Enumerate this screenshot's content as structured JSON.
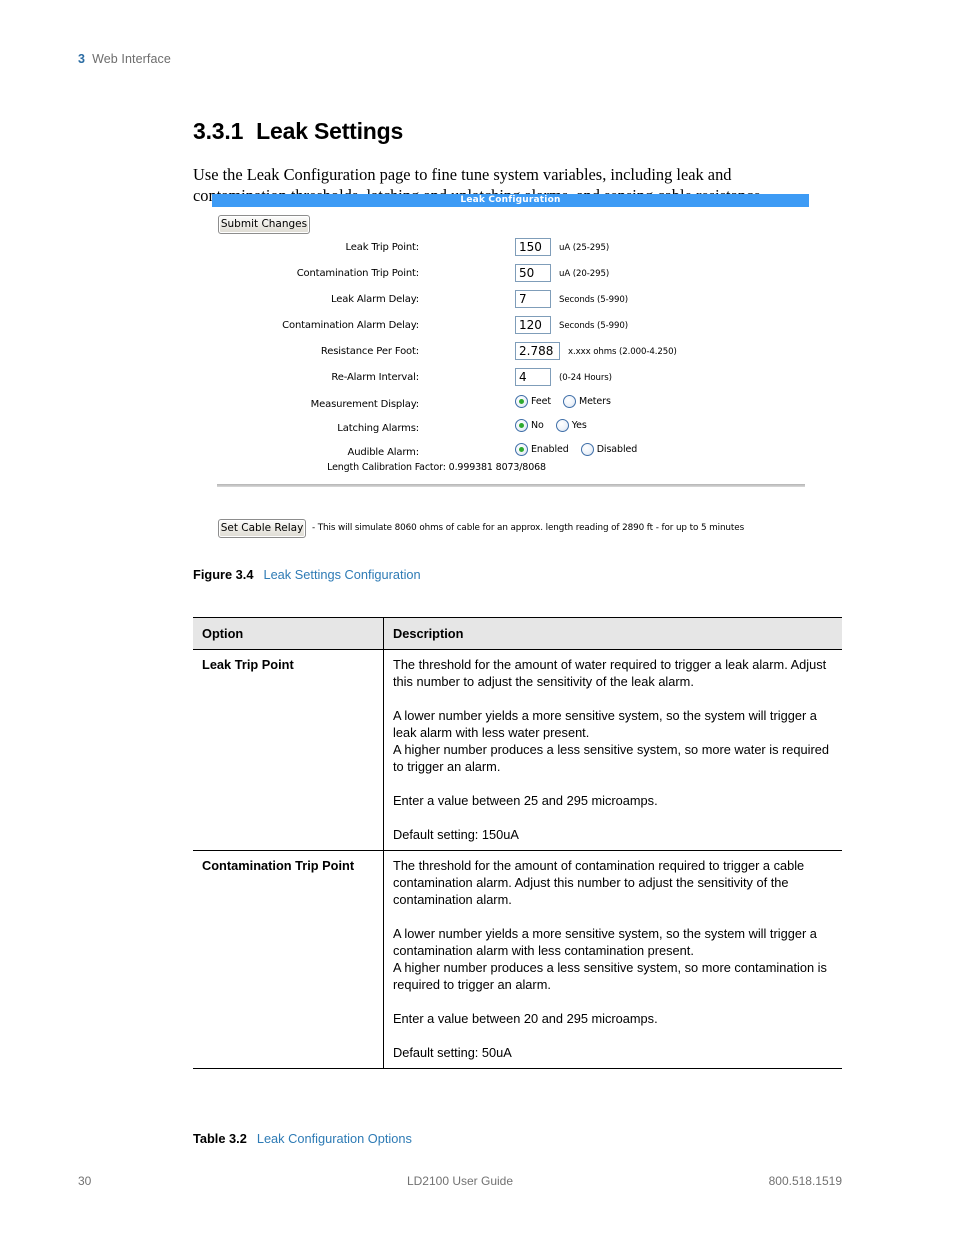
{
  "header": {
    "chapter_number": "3",
    "chapter_name": "Web Interface"
  },
  "section": {
    "number": "3.3.1",
    "title": "Leak Settings",
    "intro": "Use the Leak Configuration page to fine tune system variables, including leak and contamination thresholds, latching and unlatching alarms, and sensing cable resistance."
  },
  "figure_screenshot": {
    "app_title": "Leak Configuration",
    "submit_button": "Submit Changes",
    "fields": [
      {
        "label": "Leak Trip Point:",
        "value": "150",
        "hint": "uA (25-295)"
      },
      {
        "label": "Contamination Trip Point:",
        "value": "50",
        "hint": "uA (20-295)"
      },
      {
        "label": "Leak Alarm Delay:",
        "value": "7",
        "hint": "Seconds (5-990)"
      },
      {
        "label": "Contamination Alarm Delay:",
        "value": "120",
        "hint": "Seconds (5-990)"
      },
      {
        "label": "Resistance Per Foot:",
        "value": "2.788",
        "hint": "x.xxx ohms (2.000-4.250)"
      },
      {
        "label": "Re-Alarm Interval:",
        "value": "4",
        "hint": "(0-24 Hours)"
      }
    ],
    "radio_rows": [
      {
        "label": "Measurement Display:",
        "options": [
          {
            "label": "Feet",
            "selected": true
          },
          {
            "label": "Meters",
            "selected": false
          }
        ]
      },
      {
        "label": "Latching Alarms:",
        "options": [
          {
            "label": "No",
            "selected": true
          },
          {
            "label": "Yes",
            "selected": false
          }
        ]
      },
      {
        "label": "Audible Alarm:",
        "options": [
          {
            "label": "Enabled",
            "selected": true
          },
          {
            "label": "Disabled",
            "selected": false
          }
        ]
      }
    ],
    "calibration_line": "Length Calibration Factor: 0.999381 8073/8068",
    "relay_button": "Set Cable Relay",
    "relay_note": "- This will simulate 8060 ohms of cable for an approx. length reading of 2890 ft - for up to 5 minutes",
    "accent_color": "#3d9bf5",
    "radio_selected_color": "#2faa2f"
  },
  "figure_caption": {
    "number": "Figure 3.4",
    "text": "Leak Settings Configuration"
  },
  "table": {
    "columns": [
      "Option",
      "Description"
    ],
    "rows": [
      {
        "option": "Leak Trip Point",
        "description": [
          "The threshold for the amount of water required to trigger a leak alarm. Adjust this number to adjust the sensitivity of the leak alarm.",
          "A lower number yields a more sensitive system, so the system will trigger a leak alarm with less water present.",
          "A higher number produces a less sensitive system, so more water is required to trigger an alarm.",
          "Enter a value between 25 and 295 microamps.",
          "Default setting: 150uA"
        ]
      },
      {
        "option": "Contamination Trip Point",
        "description": [
          "The threshold for the amount of contamination required to trigger a cable contamination alarm. Adjust this number to adjust the sensitivity of the contamination alarm.",
          "A lower number yields a more sensitive system, so the system will trigger a contamination alarm with less contamination present.",
          "A higher number produces a less sensitive system, so more contamination is required to trigger an alarm.",
          "Enter a value between 20 and 295 microamps.",
          "Default setting: 50uA"
        ]
      }
    ]
  },
  "table_caption": {
    "number": "Table 3.2",
    "text": "Leak Configuration Options"
  },
  "footer": {
    "page_number": "30",
    "document_title": "LD2100 User Guide",
    "phone": "800.518.1519"
  }
}
